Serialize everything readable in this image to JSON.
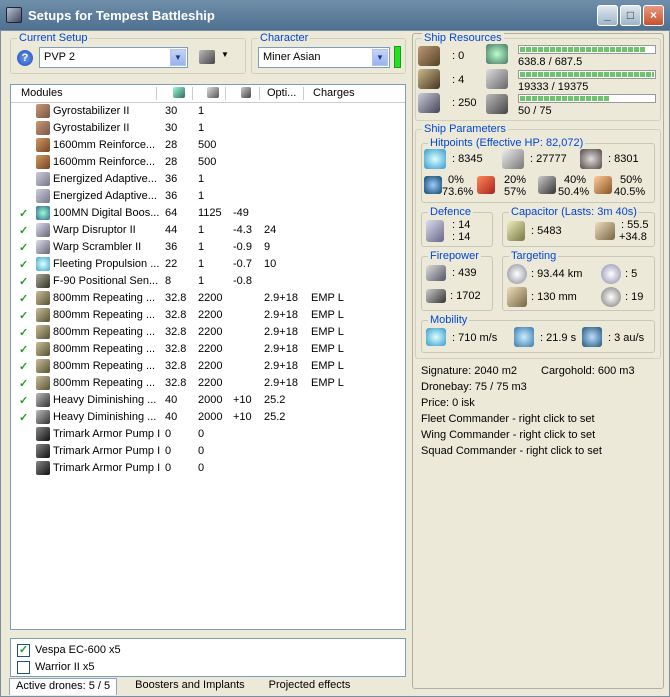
{
  "window": {
    "title": "Setups for Tempest Battleship",
    "minimize": "_",
    "maximize": "□",
    "close": "×"
  },
  "current_setup": {
    "label": "Current Setup",
    "help": "?",
    "value": "PVP 2",
    "arrow": "▼"
  },
  "character": {
    "label": "Character",
    "value": "Miner Asian",
    "arrow": "▼",
    "indicator_color": "#22e022"
  },
  "modules": {
    "headers": {
      "name": "Modules",
      "optimal": "Opti...",
      "charges": "Charges"
    },
    "rows": [
      {
        "checked": false,
        "name": "Gyrostabilizer II",
        "cpu": "30",
        "pg": "1",
        "cap": "",
        "opt": "",
        "charges": ""
      },
      {
        "checked": false,
        "name": "Gyrostabilizer II",
        "cpu": "30",
        "pg": "1",
        "cap": "",
        "opt": "",
        "charges": ""
      },
      {
        "checked": false,
        "name": "1600mm Reinforce...",
        "cpu": "28",
        "pg": "500",
        "cap": "",
        "opt": "",
        "charges": ""
      },
      {
        "checked": false,
        "name": "1600mm Reinforce...",
        "cpu": "28",
        "pg": "500",
        "cap": "",
        "opt": "",
        "charges": ""
      },
      {
        "checked": false,
        "name": "Energized Adaptive...",
        "cpu": "36",
        "pg": "1",
        "cap": "",
        "opt": "",
        "charges": ""
      },
      {
        "checked": false,
        "name": "Energized Adaptive...",
        "cpu": "36",
        "pg": "1",
        "cap": "",
        "opt": "",
        "charges": ""
      },
      {
        "checked": true,
        "name": "100MN Digital Boos...",
        "cpu": "64",
        "pg": "1125",
        "cap": "-49",
        "opt": "",
        "charges": ""
      },
      {
        "checked": true,
        "name": "Warp Disruptor II",
        "cpu": "44",
        "pg": "1",
        "cap": "-4.3",
        "opt": "24",
        "charges": ""
      },
      {
        "checked": true,
        "name": "Warp Scrambler II",
        "cpu": "36",
        "pg": "1",
        "cap": "-0.9",
        "opt": "9",
        "charges": ""
      },
      {
        "checked": true,
        "name": "Fleeting Propulsion ...",
        "cpu": "22",
        "pg": "1",
        "cap": "-0.7",
        "opt": "10",
        "charges": ""
      },
      {
        "checked": true,
        "name": "F-90 Positional Sen...",
        "cpu": "8",
        "pg": "1",
        "cap": "-0.8",
        "opt": "",
        "charges": ""
      },
      {
        "checked": true,
        "name": "800mm Repeating ...",
        "cpu": "32.8",
        "pg": "2200",
        "cap": "",
        "opt": "2.9+18",
        "charges": "EMP L"
      },
      {
        "checked": true,
        "name": "800mm Repeating ...",
        "cpu": "32.8",
        "pg": "2200",
        "cap": "",
        "opt": "2.9+18",
        "charges": "EMP L"
      },
      {
        "checked": true,
        "name": "800mm Repeating ...",
        "cpu": "32.8",
        "pg": "2200",
        "cap": "",
        "opt": "2.9+18",
        "charges": "EMP L"
      },
      {
        "checked": true,
        "name": "800mm Repeating ...",
        "cpu": "32.8",
        "pg": "2200",
        "cap": "",
        "opt": "2.9+18",
        "charges": "EMP L"
      },
      {
        "checked": true,
        "name": "800mm Repeating ...",
        "cpu": "32.8",
        "pg": "2200",
        "cap": "",
        "opt": "2.9+18",
        "charges": "EMP L"
      },
      {
        "checked": true,
        "name": "800mm Repeating ...",
        "cpu": "32.8",
        "pg": "2200",
        "cap": "",
        "opt": "2.9+18",
        "charges": "EMP L"
      },
      {
        "checked": true,
        "name": "Heavy Diminishing ...",
        "cpu": "40",
        "pg": "2000",
        "cap": "+10",
        "opt": "25.2",
        "charges": ""
      },
      {
        "checked": true,
        "name": "Heavy Diminishing ...",
        "cpu": "40",
        "pg": "2000",
        "cap": "+10",
        "opt": "25.2",
        "charges": ""
      },
      {
        "checked": false,
        "name": "Trimark Armor Pump I",
        "cpu": "0",
        "pg": "0",
        "cap": "",
        "opt": "",
        "charges": ""
      },
      {
        "checked": false,
        "name": "Trimark Armor Pump I",
        "cpu": "0",
        "pg": "0",
        "cap": "",
        "opt": "",
        "charges": ""
      },
      {
        "checked": false,
        "name": "Trimark Armor Pump I",
        "cpu": "0",
        "pg": "0",
        "cap": "",
        "opt": "",
        "charges": ""
      }
    ]
  },
  "drones": [
    {
      "checked": true,
      "name": "Vespa EC-600 x5"
    },
    {
      "checked": false,
      "name": "Warrior II x5"
    }
  ],
  "tabs": {
    "active_drones": "Active drones: 5 / 5",
    "boosters": "Boosters and Implants",
    "projected": "Projected effects"
  },
  "ship_resources": {
    "label": "Ship Resources",
    "turret_slots": ": 0",
    "launcher_slots": ": 4",
    "drone_bandwidth": ": 250",
    "cpu_text": "638.8 / 687.5",
    "cpu_pct": 0.93,
    "powergrid_text": "19333 / 19375",
    "powergrid_pct": 0.998,
    "calibration_text": "50 / 75",
    "calibration_pct": 0.667
  },
  "ship_parameters": {
    "label": "Ship Parameters",
    "hitpoints_label": "Hitpoints (Effective HP: 82,072)",
    "shield_hp": ": 8345",
    "armor_hp": ": 27777",
    "hull_hp": ": 8301",
    "shield_res_top": "0%",
    "shield_res_bottom": "73.6%",
    "armor_res_top": "20%",
    "armor_res_bottom": "57%",
    "kin_res_top": "40%",
    "kin_res_bottom": "50.4%",
    "exp_res_top": "50%",
    "exp_res_bottom": "40.5%",
    "defence_label": "Defence",
    "defence_top": ": 14",
    "defence_bottom": ": 14",
    "capacitor_label": "Capacitor (Lasts: 3m 40s)",
    "capacitor_amount": ": 5483",
    "capacitor_use": ": 55.5",
    "capacitor_recharge": "+34.8",
    "firepower_label": "Firepower",
    "firepower_top": ": 439",
    "firepower_bottom": ": 1702",
    "targeting_label": "Targeting",
    "target_range": ": 93.44 km",
    "max_targets": ": 5",
    "sensor_res": ": 130 mm",
    "sensor_strength": ": 19",
    "mobility_label": "Mobility",
    "velocity": ": 710 m/s",
    "align_time": ": 21.9 s",
    "warp_speed": ": 3 au/s"
  },
  "stats": {
    "signature": "Signature: 2040 m2",
    "cargohold": "Cargohold: 600 m3",
    "dronebay": "Dronebay: 75 / 75 m3",
    "price": "Price: 0 isk",
    "fleet_commander": "Fleet Commander - right click to set",
    "wing_commander": "Wing Commander - right click to set",
    "squad_commander": "Squad Commander - right click to set"
  }
}
